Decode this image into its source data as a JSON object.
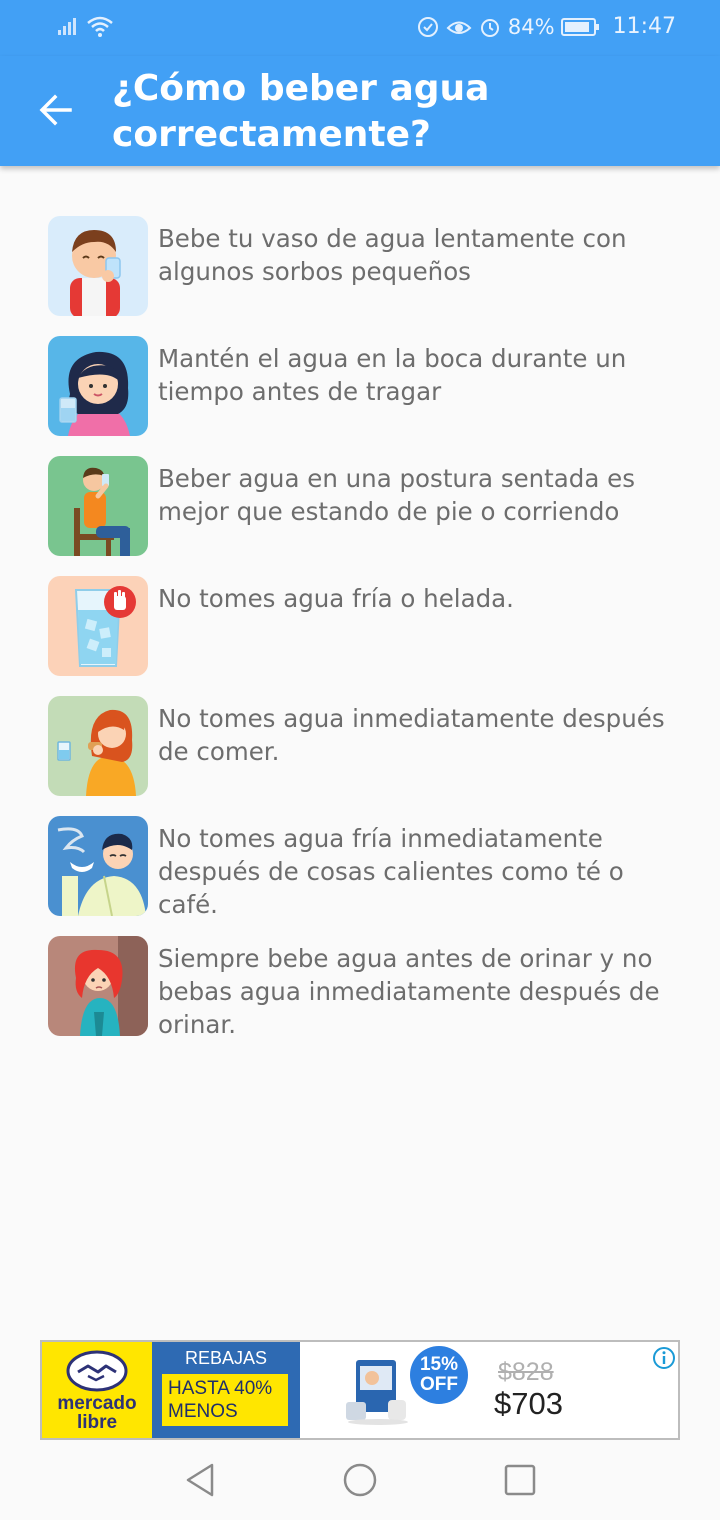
{
  "status_bar": {
    "battery": "84%",
    "time": "11:47",
    "icons": [
      "signal-icon",
      "wifi-icon",
      "data-saver-icon",
      "eye-comfort-icon",
      "alarm-icon",
      "battery-icon"
    ]
  },
  "app_bar": {
    "title": "¿Cómo beber agua correctamente?",
    "back_icon": "arrow-left-icon",
    "color": "#42a0f5"
  },
  "tips": [
    {
      "text": "Bebe tu vaso de agua lentamente con algunos sorbos pequeños",
      "image": "boy-drinking-illustration"
    },
    {
      "text": "Mantén el agua en la boca durante un tiempo antes de tragar",
      "image": "woman-holding-glass-illustration"
    },
    {
      "text": "Beber agua en una postura sentada es mejor que estando de pie o corriendo",
      "image": "man-sitting-drinking-illustration"
    },
    {
      "text": "No tomes agua fría o helada.",
      "image": "ice-water-stop-illustration"
    },
    {
      "text": "No tomes agua inmediatamente después de comer.",
      "image": "woman-eating-illustration"
    },
    {
      "text": "No tomes agua fría inmediatamente después de cosas calientes como té o café.",
      "image": "man-hot-tea-illustration"
    },
    {
      "text": "Siempre bebe agua antes de orinar y no bebas agua inmediatamente después de orinar.",
      "image": "girl-bathroom-illustration"
    }
  ],
  "ad": {
    "brand_line1": "mercado",
    "brand_line2": "libre",
    "rebajas": "REBAJAS",
    "hasta_line1": "HASTA 40%",
    "hasta_line2": "MENOS",
    "badge_line1": "15%",
    "badge_line2": "OFF",
    "old_price": "$828",
    "new_price": "$703"
  },
  "nav_bar": {
    "buttons": [
      "back-triangle-icon",
      "home-circle-icon",
      "recents-square-icon"
    ]
  }
}
